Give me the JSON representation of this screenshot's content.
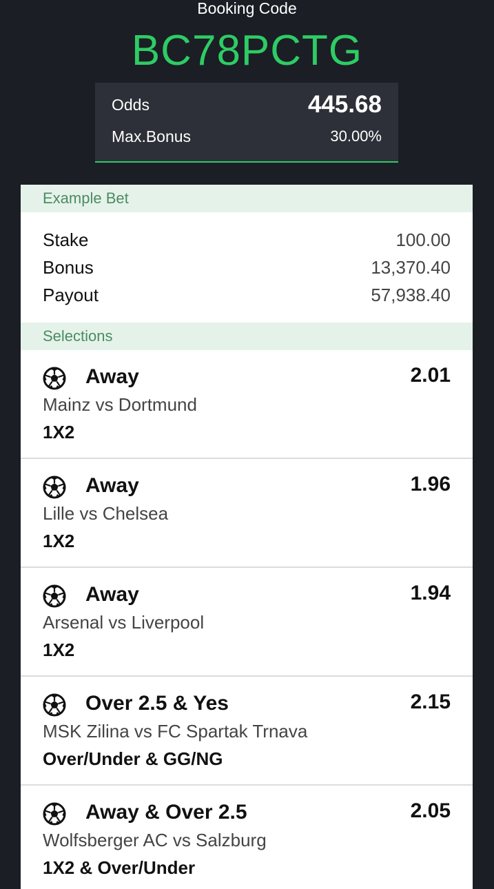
{
  "header": {
    "title": "Booking Code",
    "code": "BC78PCTG"
  },
  "odds_box": {
    "odds_label": "Odds",
    "odds_value": "445.68",
    "bonus_label": "Max.Bonus",
    "bonus_value": "30.00%"
  },
  "example_bet": {
    "title": "Example Bet",
    "rows": [
      {
        "label": "Stake",
        "value": "100.00"
      },
      {
        "label": "Bonus",
        "value": "13,370.40"
      },
      {
        "label": "Payout",
        "value": "57,938.40"
      }
    ]
  },
  "selections": {
    "title": "Selections",
    "items": [
      {
        "icon": "soccer-ball-icon",
        "pick": "Away",
        "odds": "2.01",
        "match": "Mainz vs Dortmund",
        "market": "1X2"
      },
      {
        "icon": "soccer-ball-icon",
        "pick": "Away",
        "odds": "1.96",
        "match": "Lille vs Chelsea",
        "market": "1X2"
      },
      {
        "icon": "soccer-ball-icon",
        "pick": "Away",
        "odds": "1.94",
        "match": "Arsenal vs Liverpool",
        "market": "1X2"
      },
      {
        "icon": "soccer-ball-icon",
        "pick": "Over 2.5 & Yes",
        "odds": "2.15",
        "match": "MSK Zilina vs FC Spartak Trnava",
        "market": "Over/Under & GG/NG"
      },
      {
        "icon": "soccer-ball-icon",
        "pick": "Away & Over 2.5",
        "odds": "2.05",
        "match": "Wolfsberger AC vs Salzburg",
        "market": "1X2 & Over/Under"
      }
    ]
  },
  "colors": {
    "background": "#1b1e25",
    "accent": "#2ecc64",
    "section_header_bg": "#e5f2ea",
    "section_header_text": "#4a8c60"
  }
}
